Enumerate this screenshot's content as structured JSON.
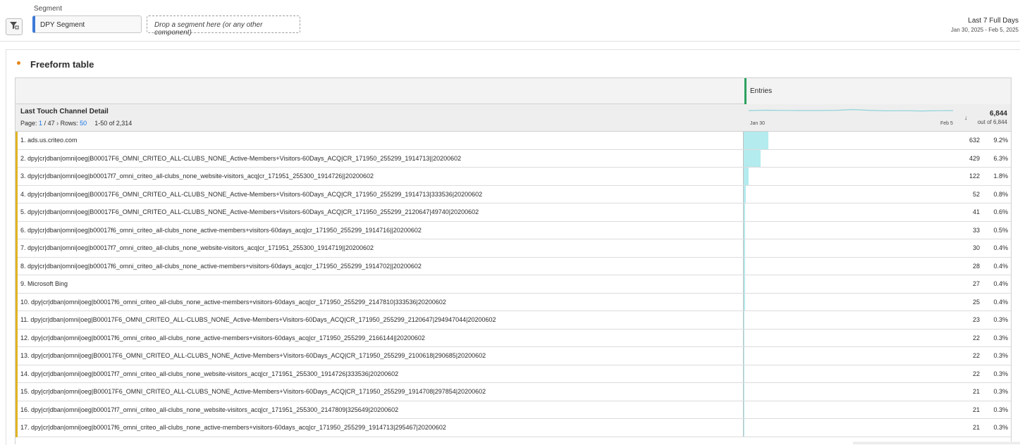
{
  "segment": {
    "label": "Segment",
    "chip": "DPY Segment",
    "drop_placeholder": "Drop a segment here (or any other component)"
  },
  "date": {
    "title": "Last 7 Full Days",
    "range": "Jan 30, 2025 - Feb 5, 2025"
  },
  "panel": {
    "title": "Freeform table"
  },
  "table": {
    "metric_header": "Entries",
    "dimension": "Last Touch Channel Detail",
    "pager": {
      "page_label": "Page:",
      "page": "1",
      "page_total": "/ 47",
      "rows_label": "Rows:",
      "rows": "50",
      "range": "1-50 of 2,314"
    },
    "spark": {
      "start": "Jan 30",
      "end": "Feb 5"
    },
    "total": "6,844",
    "total_sub": "out of 6,844",
    "rows": [
      {
        "label": "1.  ads.us.criteo.com",
        "value": "632",
        "pct": "9.2%",
        "share": 0.092
      },
      {
        "label": "2.  dpy|cr|dban|omni|oeg|B00017F6_OMNI_CRITEO_ALL-CLUBS_NONE_Active-Members+Visitors-60Days_ACQ|CR_171950_255299_1914713||20200602",
        "value": "429",
        "pct": "6.3%",
        "share": 0.063
      },
      {
        "label": "3.  dpy|cr|dban|omni|oeg|b00017f7_omni_criteo_all-clubs_none_website-visitors_acq|cr_171951_255300_1914726||20200602",
        "value": "122",
        "pct": "1.8%",
        "share": 0.018
      },
      {
        "label": "4.  dpy|cr|dban|omni|oeg|B00017F6_OMNI_CRITEO_ALL-CLUBS_NONE_Active-Members+Visitors-60Days_ACQ|CR_171950_255299_1914713|333536|20200602",
        "value": "52",
        "pct": "0.8%",
        "share": 0.008
      },
      {
        "label": "5.  dpy|cr|dban|omni|oeg|B00017F6_OMNI_CRITEO_ALL-CLUBS_NONE_Active-Members+Visitors-60Days_ACQ|CR_171950_255299_2120647|49740|20200602",
        "value": "41",
        "pct": "0.6%",
        "share": 0.006
      },
      {
        "label": "6.  dpy|cr|dban|omni|oeg|b00017f6_omni_criteo_all-clubs_none_active-members+visitors-60days_acq|cr_171950_255299_1914716||20200602",
        "value": "33",
        "pct": "0.5%",
        "share": 0.005
      },
      {
        "label": "7.  dpy|cr|dban|omni|oeg|b00017f7_omni_criteo_all-clubs_none_website-visitors_acq|cr_171951_255300_1914719||20200602",
        "value": "30",
        "pct": "0.4%",
        "share": 0.004
      },
      {
        "label": "8.  dpy|cr|dban|omni|oeg|b00017f6_omni_criteo_all-clubs_none_active-members+visitors-60days_acq|cr_171950_255299_1914702||20200602",
        "value": "28",
        "pct": "0.4%",
        "share": 0.004
      },
      {
        "label": "9.  Microsoft Bing",
        "value": "27",
        "pct": "0.4%",
        "share": 0.004
      },
      {
        "label": "10.  dpy|cr|dban|omni|oeg|b00017f6_omni_criteo_all-clubs_none_active-members+visitors-60days_acq|cr_171950_255299_2147810|333536|20200602",
        "value": "25",
        "pct": "0.4%",
        "share": 0.004
      },
      {
        "label": "11.  dpy|cr|dban|omni|oeg|B00017F6_OMNI_CRITEO_ALL-CLUBS_NONE_Active-Members+Visitors-60Days_ACQ|CR_171950_255299_2120647|294947044|20200602",
        "value": "23",
        "pct": "0.3%",
        "share": 0.003
      },
      {
        "label": "12.  dpy|cr|dban|omni|oeg|b00017f6_omni_criteo_all-clubs_none_active-members+visitors-60days_acq|cr_171950_255299_2166144||20200602",
        "value": "22",
        "pct": "0.3%",
        "share": 0.003
      },
      {
        "label": "13.  dpy|cr|dban|omni|oeg|B00017F6_OMNI_CRITEO_ALL-CLUBS_NONE_Active-Members+Visitors-60Days_ACQ|CR_171950_255299_2100618|290685|20200602",
        "value": "22",
        "pct": "0.3%",
        "share": 0.003
      },
      {
        "label": "14.  dpy|cr|dban|omni|oeg|b00017f7_omni_criteo_all-clubs_none_website-visitors_acq|cr_171951_255300_1914726|333536|20200602",
        "value": "22",
        "pct": "0.3%",
        "share": 0.003
      },
      {
        "label": "15.  dpy|cr|dban|omni|oeg|B00017F6_OMNI_CRITEO_ALL-CLUBS_NONE_Active-Members+Visitors-60Days_ACQ|CR_171950_255299_1914708|297854|20200602",
        "value": "21",
        "pct": "0.3%",
        "share": 0.003
      },
      {
        "label": "16.  dpy|cr|dban|omni|oeg|b00017f7_omni_criteo_all-clubs_none_website-visitors_acq|cr_171951_255300_2147809|325649|20200602",
        "value": "21",
        "pct": "0.3%",
        "share": 0.003
      },
      {
        "label": "17.  dpy|cr|dban|omni|oeg|b00017f6_omni_criteo_all-clubs_none_active-members+visitors-60days_acq|cr_171950_255299_1914713|295467|20200602",
        "value": "21",
        "pct": "0.3%",
        "share": 0.003
      }
    ]
  }
}
